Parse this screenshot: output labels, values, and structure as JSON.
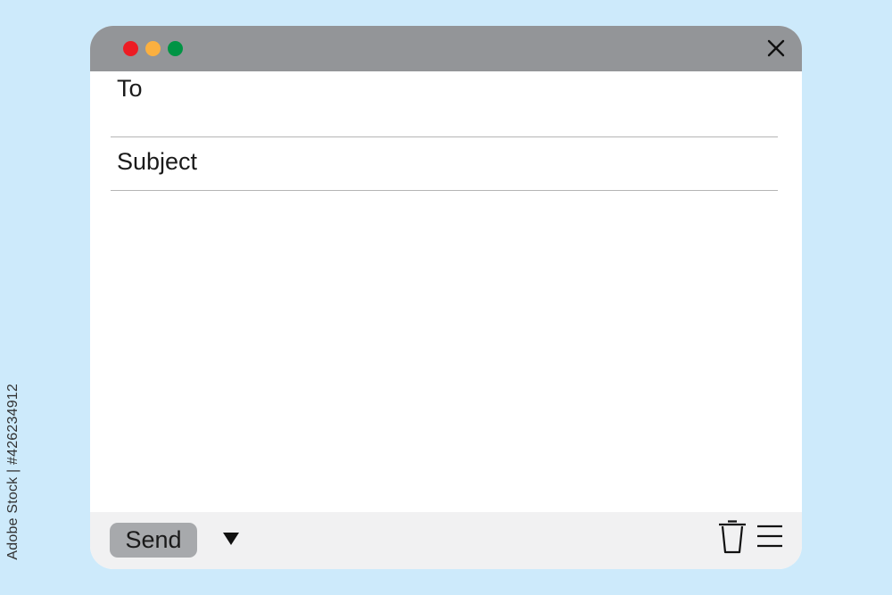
{
  "window": {
    "traffic_lights": {
      "close_color": "#ed1c24",
      "minimize_color": "#fbb040",
      "maximize_color": "#009444"
    },
    "close_icon": "x-icon"
  },
  "compose": {
    "to_label": "To",
    "to_value": "",
    "subject_label": "Subject",
    "subject_value": "",
    "body_value": ""
  },
  "footer": {
    "send_label": "Send",
    "dropdown_icon": "triangle-down-icon",
    "trash_icon": "trash-icon",
    "menu_icon": "hamburger-menu-icon"
  },
  "watermark": {
    "text": "Adobe Stock | #426234912"
  }
}
